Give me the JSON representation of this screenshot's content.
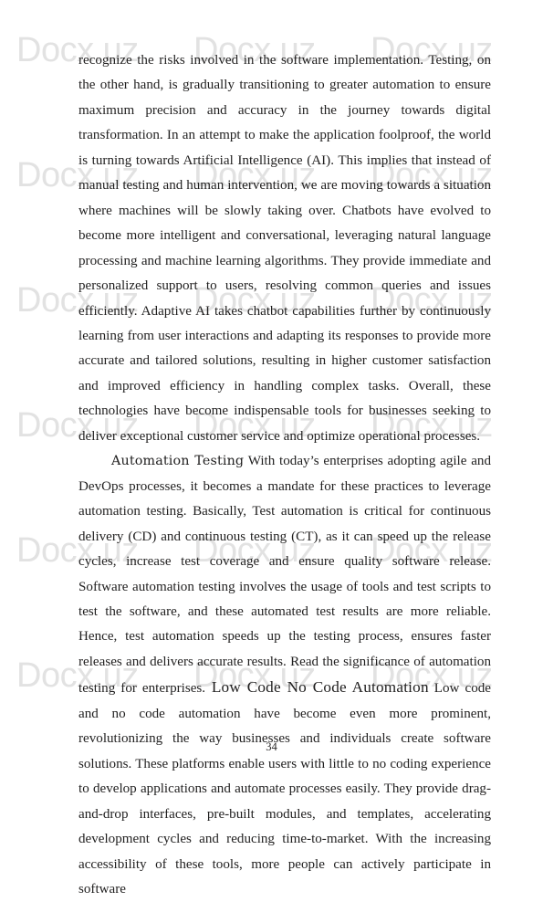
{
  "page": {
    "page_number": "34",
    "background_color": "#ffffff",
    "text_color": "#201f1f"
  },
  "watermark": {
    "text": "Docx.uz",
    "color": "#e2e2e2",
    "columns_x": [
      18,
      212,
      406
    ],
    "rows_y": [
      36,
      173,
      310,
      447,
      584,
      721
    ],
    "offset_rows_y": []
  },
  "content": {
    "paragraph_1": "recognize the risks involved in the software implementation. Testing, on the other hand, is gradually transitioning to greater automation to ensure maximum precision and accuracy in the journey towards digital transformation. In an attempt to make the application foolproof, the world is turning towards Artificial Intelligence (AI). This implies that instead of manual testing and human intervention, we are moving towards a situation where machines will be slowly taking over. Chatbots have evolved to become more intelligent and conversational, leveraging natural language processing and machine learning algorithms. They provide immediate and personalized support to users, resolving common queries and issues efficiently. Adaptive AI takes chatbot capabilities further by continuously learning from user interactions and adapting its responses to provide more accurate and tailored solutions, resulting in higher customer satisfaction and improved efficiency in handling complex tasks. Overall, these technologies have become indispensable tools for businesses seeking to deliver exceptional customer service and optimize operational processes.",
    "paragraph_2_heading_1": "Automation Testing",
    "paragraph_2_part_a": " With today’s enterprises adopting agile and DevOps processes, it becomes a mandate for these practices to leverage automation testing. Basically, Test automation is critical for continuous delivery (CD) and continuous testing (CT), as it can speed up the release cycles, increase test coverage and ensure quality software release. Software automation testing involves the usage of tools and test scripts to test the software, and these automated test results are more reliable. Hence, test automation speeds up the testing process, ensures faster releases and delivers accurate results. Read the significance of automation testing for enterprises.",
    "paragraph_2_heading_2": " Low Code No Code Automation",
    "paragraph_2_part_b": " Low code and no code automation have become even more prominent, revolutionizing the way businesses and individuals create software solutions. These platforms enable users with little to no coding experience to develop applications and automate processes easily. They provide drag-and-drop interfaces, pre-built modules, and templates, accelerating development cycles and reducing time-to-market. With the increasing accessibility of these tools, more people can actively participate in software"
  }
}
